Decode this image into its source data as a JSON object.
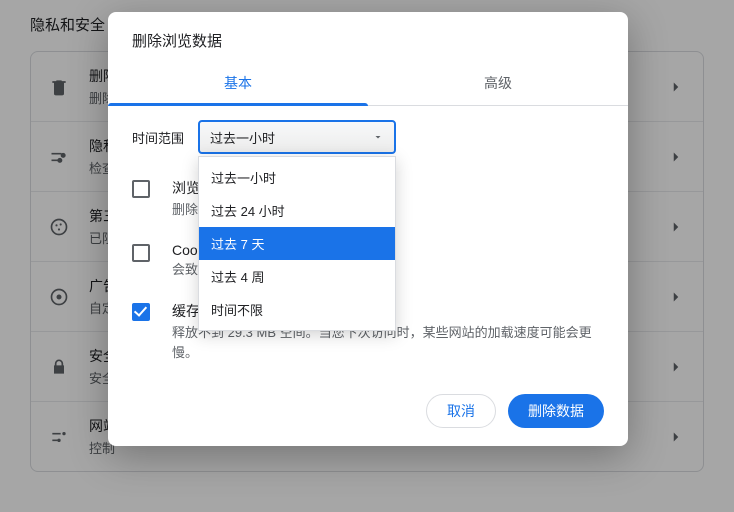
{
  "page": {
    "title": "隐私和安全"
  },
  "rows": [
    {
      "title": "删除",
      "sub": "删除"
    },
    {
      "title": "隐私",
      "sub": "检查"
    },
    {
      "title": "第三",
      "sub": "已阻"
    },
    {
      "title": "广告",
      "sub": "自定"
    },
    {
      "title": "安全",
      "sub": "安全"
    },
    {
      "title": "网站",
      "sub": "控制"
    }
  ],
  "dialog": {
    "title": "删除浏览数据",
    "tabs": {
      "basic": "基本",
      "advanced": "高级"
    },
    "time_range_label": "时间范围",
    "select": {
      "value": "过去一小时",
      "options": [
        "过去一小时",
        "过去 24 小时",
        "过去 7 天",
        "过去 4 周",
        "时间不限"
      ],
      "highlight_index": 2
    },
    "checks": [
      {
        "checked": false,
        "title": "浏览",
        "sub": "删除"
      },
      {
        "checked": false,
        "title": "Cook",
        "sub": "会致"
      },
      {
        "checked": true,
        "title": "缓存的图片和文件",
        "sub": "释放不到 29.3 MB 空间。当您下次访问时，某些网站的加载速度可能会更慢。"
      }
    ],
    "actions": {
      "cancel": "取消",
      "confirm": "删除数据"
    }
  }
}
